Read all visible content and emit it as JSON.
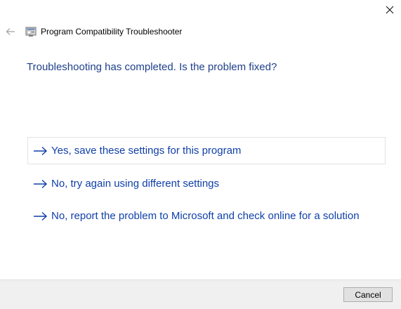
{
  "window": {
    "title": "Program Compatibility Troubleshooter",
    "close_icon": "close-icon",
    "back_icon": "back-arrow-icon"
  },
  "main": {
    "heading": "Troubleshooting has completed.  Is the problem fixed?",
    "options": [
      {
        "label": "Yes, save these settings for this program",
        "icon": "arrow-right-icon",
        "focused": true
      },
      {
        "label": "No, try again using different settings",
        "icon": "arrow-right-icon",
        "focused": false
      },
      {
        "label": "No, report the problem to Microsoft and check online for a solution",
        "icon": "arrow-right-icon",
        "focused": false
      }
    ]
  },
  "footer": {
    "cancel_label": "Cancel"
  },
  "colors": {
    "heading": "#1e3f8a",
    "link": "#0f3fa8",
    "footer_bg": "#f0f0f0"
  }
}
